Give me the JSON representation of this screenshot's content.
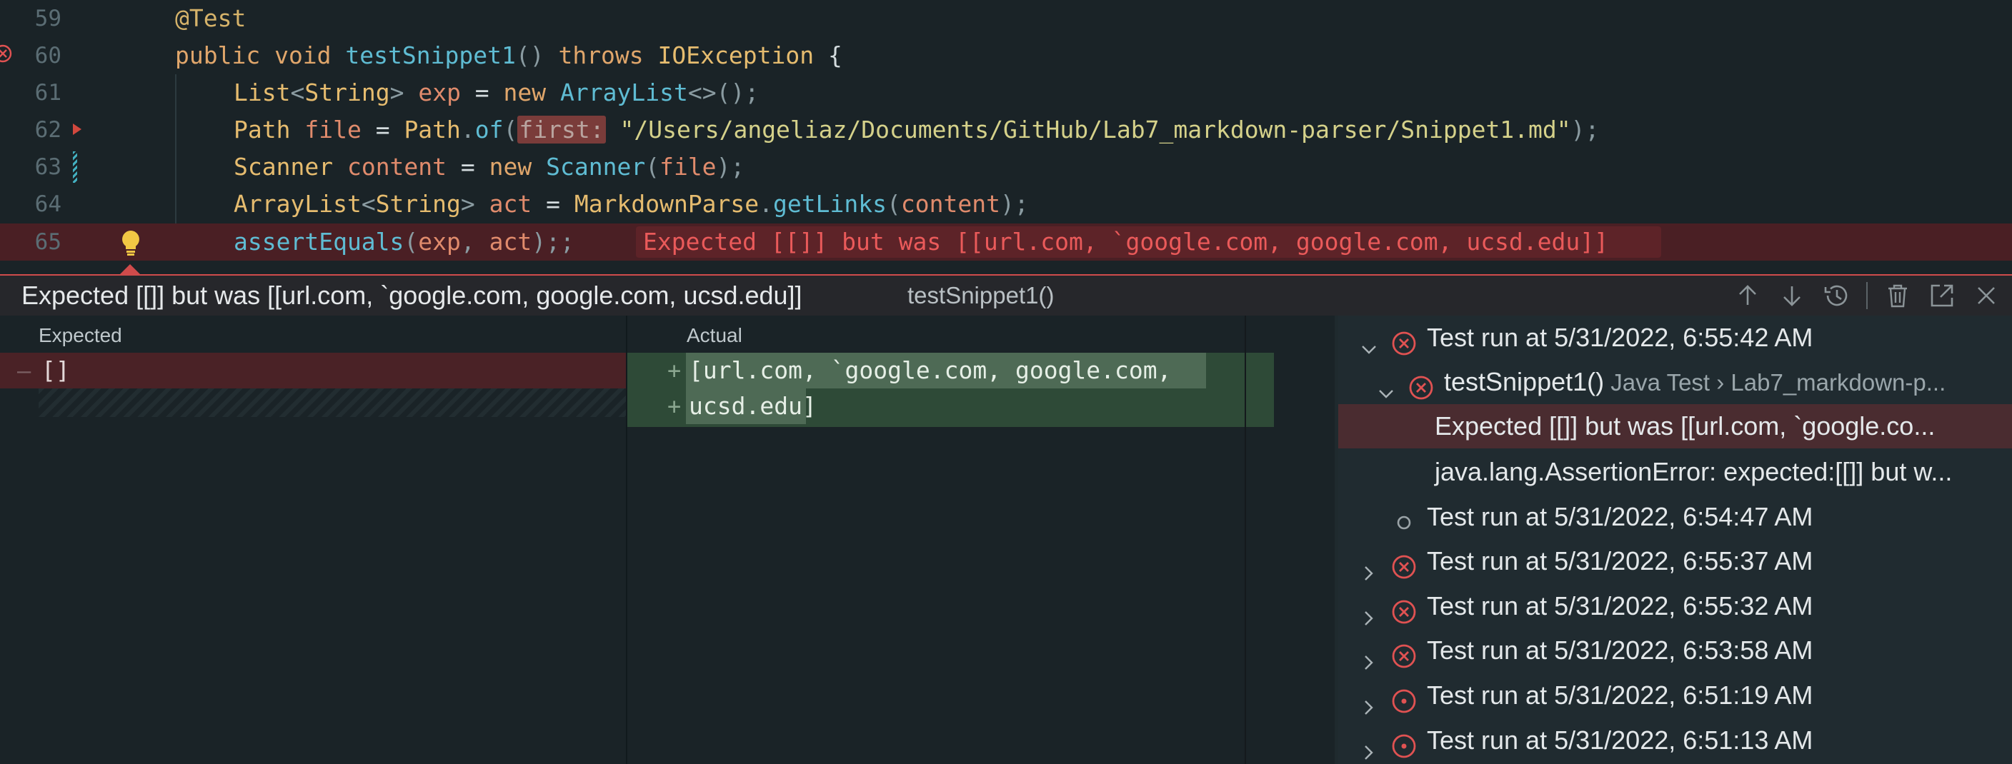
{
  "editor": {
    "lines": [
      {
        "num": "59",
        "segments": [
          {
            "t": "@Test",
            "c": "k-ann"
          }
        ]
      },
      {
        "num": "60",
        "segments": [
          {
            "t": "public void ",
            "c": "k-kw"
          },
          {
            "t": "testSnippet1",
            "c": "k-fn"
          },
          {
            "t": "() ",
            "c": "k-pun"
          },
          {
            "t": "throws ",
            "c": "k-kw"
          },
          {
            "t": "IOException ",
            "c": "k-type"
          },
          {
            "t": "{",
            "c": "k-plain"
          }
        ]
      },
      {
        "num": "61",
        "segments": [
          {
            "t": "List",
            "c": "k-type"
          },
          {
            "t": "<",
            "c": "k-pun"
          },
          {
            "t": "String",
            "c": "k-type"
          },
          {
            "t": "> ",
            "c": "k-pun"
          },
          {
            "t": "exp",
            "c": "k-var"
          },
          {
            "t": " = ",
            "c": "k-plain"
          },
          {
            "t": "new ",
            "c": "k-kw"
          },
          {
            "t": "ArrayList",
            "c": "k-fn"
          },
          {
            "t": "<>();",
            "c": "k-pun"
          }
        ]
      },
      {
        "num": "62",
        "segments": [
          {
            "t": "Path ",
            "c": "k-type"
          },
          {
            "t": "file",
            "c": "k-var"
          },
          {
            "t": " = ",
            "c": "k-plain"
          },
          {
            "t": "Path",
            "c": "k-type"
          },
          {
            "t": ".",
            "c": "k-pun"
          },
          {
            "t": "of",
            "c": "k-fn"
          },
          {
            "t": "(",
            "c": "k-pun"
          },
          {
            "t": "first:",
            "c": "hint"
          },
          {
            "t": " ",
            "c": "k-plain"
          },
          {
            "t": "\"/Users/angeliaz/Documents/GitHub/Lab7_markdown-parser/Snippet1.md\"",
            "c": "k-str"
          },
          {
            "t": ");",
            "c": "k-pun"
          }
        ]
      },
      {
        "num": "63",
        "segments": [
          {
            "t": "Scanner ",
            "c": "k-type"
          },
          {
            "t": "content",
            "c": "k-var"
          },
          {
            "t": " = ",
            "c": "k-plain"
          },
          {
            "t": "new ",
            "c": "k-kw"
          },
          {
            "t": "Scanner",
            "c": "k-fn"
          },
          {
            "t": "(",
            "c": "k-pun"
          },
          {
            "t": "file",
            "c": "k-var"
          },
          {
            "t": ");",
            "c": "k-pun"
          }
        ]
      },
      {
        "num": "64",
        "segments": [
          {
            "t": "ArrayList",
            "c": "k-type"
          },
          {
            "t": "<",
            "c": "k-pun"
          },
          {
            "t": "String",
            "c": "k-type"
          },
          {
            "t": "> ",
            "c": "k-pun"
          },
          {
            "t": "act",
            "c": "k-var"
          },
          {
            "t": " = ",
            "c": "k-plain"
          },
          {
            "t": "MarkdownParse",
            "c": "k-type"
          },
          {
            "t": ".",
            "c": "k-pun"
          },
          {
            "t": "getLinks",
            "c": "k-fn"
          },
          {
            "t": "(",
            "c": "k-pun"
          },
          {
            "t": "content",
            "c": "k-var"
          },
          {
            "t": ");",
            "c": "k-pun"
          }
        ]
      },
      {
        "num": "65",
        "segments": [
          {
            "t": "assertEquals",
            "c": "k-fn"
          },
          {
            "t": "(",
            "c": "k-pun"
          },
          {
            "t": "exp",
            "c": "k-var"
          },
          {
            "t": ", ",
            "c": "k-pun"
          },
          {
            "t": "act",
            "c": "k-var"
          },
          {
            "t": ");;",
            "c": "k-pun"
          }
        ]
      }
    ],
    "inline_error": "Expected [[]] but was [[url.com, `google.com, google.com, ucsd.edu]]"
  },
  "peek": {
    "title": "Expected [[]] but was [[url.com, `google.com, google.com, ucsd.edu]]",
    "subtitle": "testSnippet1()",
    "actions": [
      "arrow-up-icon",
      "arrow-down-icon",
      "history-icon",
      "trash-icon",
      "open-external-icon",
      "close-icon"
    ]
  },
  "diff": {
    "expected_label": "Expected",
    "actual_label": "Actual",
    "expected_value": "[]",
    "actual_lines": [
      "[url.com, `google.com, google.com,",
      "ucsd.edu]"
    ]
  },
  "tree": [
    {
      "label": "Test run at 5/31/2022, 6:55:42 AM",
      "status": "failed",
      "expand": "open",
      "indent": 0
    },
    {
      "label": "testSnippet1()",
      "meta": "Java Test › Lab7_markdown-p...",
      "status": "failed",
      "expand": "open",
      "indent": 1
    },
    {
      "label": "Expected [[]] but was [[url.com, `google.co...",
      "status": "none",
      "expand": "none",
      "indent": 2,
      "selected": true
    },
    {
      "label": "java.lang.AssertionError: expected:[[]] but w...",
      "status": "none",
      "expand": "none",
      "indent": 2
    },
    {
      "label": "Test run at 5/31/2022, 6:54:47 AM",
      "status": "pending",
      "expand": "none",
      "indent": 0
    },
    {
      "label": "Test run at 5/31/2022, 6:55:37 AM",
      "status": "failed",
      "expand": "closed",
      "indent": 0
    },
    {
      "label": "Test run at 5/31/2022, 6:55:32 AM",
      "status": "failed",
      "expand": "closed",
      "indent": 0
    },
    {
      "label": "Test run at 5/31/2022, 6:53:58 AM",
      "status": "failed",
      "expand": "closed",
      "indent": 0
    },
    {
      "label": "Test run at 5/31/2022, 6:51:19 AM",
      "status": "errored",
      "expand": "closed",
      "indent": 0
    },
    {
      "label": "Test run at 5/31/2022, 6:51:13 AM",
      "status": "errored",
      "expand": "closed",
      "indent": 0
    }
  ],
  "colors": {
    "error": "#cf4b4b",
    "selected": "#4a2c30",
    "added": "#2e4a37",
    "removed": "#4a2226"
  }
}
